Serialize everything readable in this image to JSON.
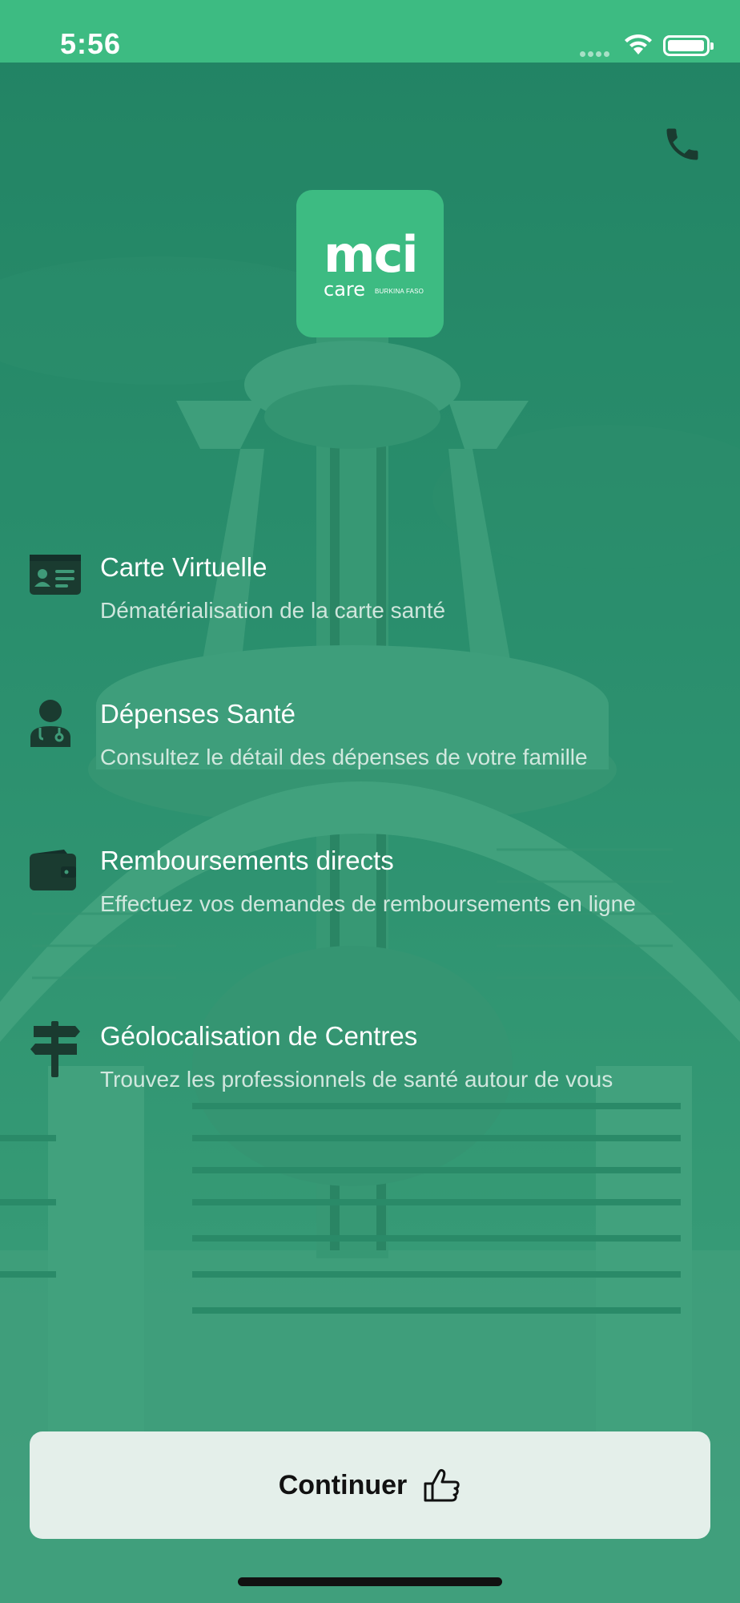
{
  "status_bar": {
    "time": "5:56"
  },
  "logo": {
    "primary": "mci",
    "secondary": "care",
    "country": "BURKINA FASO"
  },
  "features": [
    {
      "icon": "id-card-icon",
      "title": "Carte Virtuelle",
      "description": "Dématérialisation de la carte santé"
    },
    {
      "icon": "doctor-icon",
      "title": "Dépenses Santé",
      "description": "Consultez le détail des dépenses de votre famille"
    },
    {
      "icon": "wallet-icon",
      "title": "Remboursements directs",
      "description": "Effectuez vos demandes de remboursements en ligne"
    },
    {
      "icon": "signpost-icon",
      "title": "Géolocalisation de Centres",
      "description": "Trouvez les professionnels de santé autour de vous"
    }
  ],
  "actions": {
    "continue_label": "Continuer",
    "continue_icon": "thumbs-up-icon",
    "call_icon": "phone-icon"
  },
  "colors": {
    "brand": "#3dbb82",
    "button_bg": "#e4efea",
    "icon_dark": "#1a3b30"
  }
}
